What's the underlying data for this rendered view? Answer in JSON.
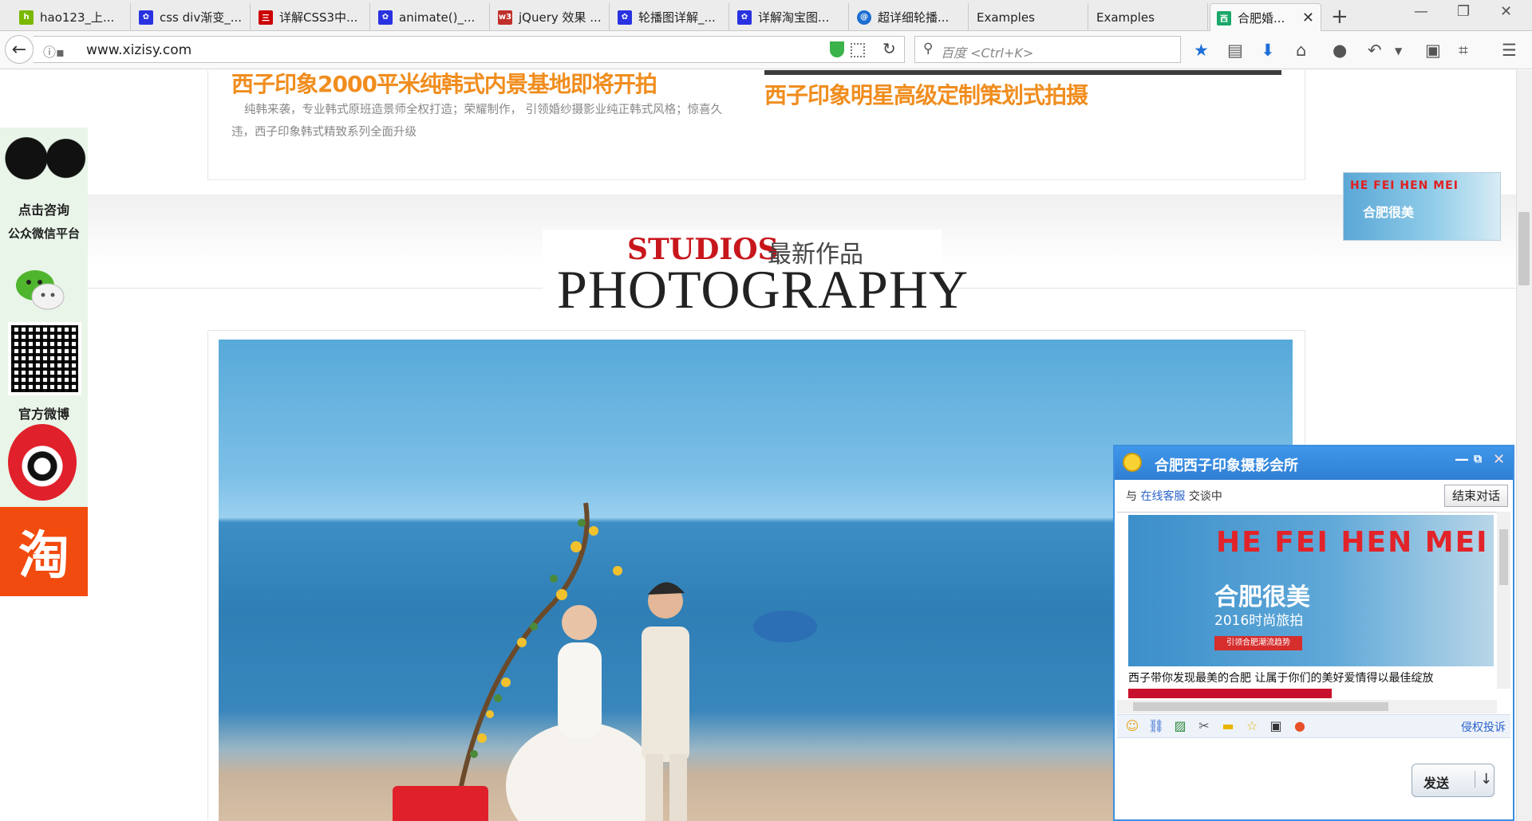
{
  "browser": {
    "tabs": [
      {
        "label": "hao123_上...",
        "icon": "hao123-favicon"
      },
      {
        "label": "css div渐变_...",
        "icon": "baidu-paw-favicon"
      },
      {
        "label": "详解CSS3中...",
        "icon": "sanlian-favicon"
      },
      {
        "label": "animate()_...",
        "icon": "baidu-paw-favicon"
      },
      {
        "label": "jQuery 效果 ...",
        "icon": "w3-favicon"
      },
      {
        "label": "轮播图详解_...",
        "icon": "baidu-paw-favicon"
      },
      {
        "label": "详解淘宝图...",
        "icon": "baidu-paw-favicon"
      },
      {
        "label": "超详细轮播...",
        "icon": "bing-favicon"
      },
      {
        "label": "Examples",
        "icon": ""
      },
      {
        "label": "Examples",
        "icon": ""
      },
      {
        "label": "合肥婚...",
        "icon": "xizi-favicon",
        "active": true
      }
    ],
    "url": "www.xizisy.com",
    "search_placeholder": "百度 <Ctrl+K>"
  },
  "news": {
    "left_title": "西子印象2000平米纯韩式内景基地即将开拍",
    "left_desc": "纯韩来袭，专业韩式原班造景师全权打造；荣耀制作， 引领婚纱摄影业纯正韩式风格；惊喜久违，西子印象韩式精致系列全面升级",
    "right_title": "西子印象明星高级定制策划式拍摄"
  },
  "section_heading": {
    "studios": "STUDIOS",
    "zuixin": "最新作品",
    "photography": "PHOTOGRAPHY"
  },
  "leftbar": {
    "consult": "点击咨询",
    "wechat_platform": "公众微信平台",
    "weibo": "官方微博",
    "taobao": "淘"
  },
  "rightad": {
    "line1": "HE FEI HEN MEI",
    "line2": "合肥很美"
  },
  "chat": {
    "title": "合肥西子印象摄影会所",
    "status_prefix": "与",
    "status_service": "在线客服",
    "status_suffix": "交谈中",
    "end_button": "结束对话",
    "ad": {
      "heading": "HE FEI HEN MEI",
      "main": "合肥很美",
      "year": "2016时尚旅拍",
      "tag": "引领合肥潮流趋势"
    },
    "message": "西子带你发现最美的合肥  让属于你们的美好爱情得以最佳绽放",
    "report_link": "侵权投诉",
    "send_button": "发送"
  }
}
